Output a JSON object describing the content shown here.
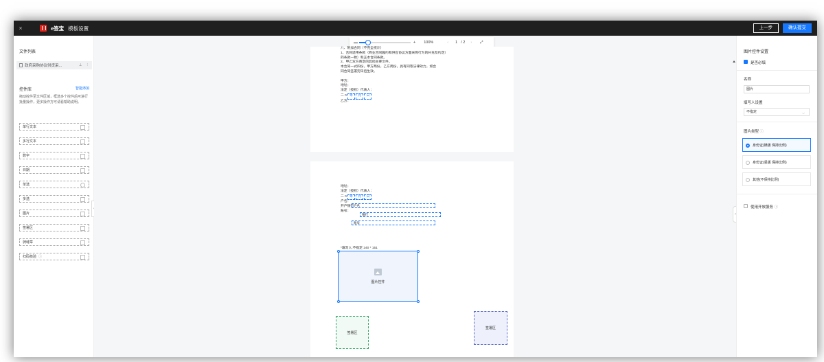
{
  "topbar": {
    "close": "×",
    "app_name": "e签宝",
    "page_title": "模板设置",
    "prev_label": "上一步",
    "submit_label": "确认提交"
  },
  "left": {
    "file_list_title": "文件列表",
    "file_name": "政府采购协议供货采...",
    "library_title": "控件库",
    "batch_add": "智能添加",
    "library_desc": "拖动控件至文件区域，框选多个控件后可进行批量操作，更多操作方可请看帮助说明。",
    "controls": [
      "单行文本",
      "多行文本",
      "数字",
      "日期",
      "单选",
      "多选",
      "图片",
      "签署区",
      "骑缝章",
      "扫码核验"
    ]
  },
  "toolbar": {
    "zoom": "100%",
    "page": "1",
    "total": "/ 2"
  },
  "page1": {
    "lines": [
      "八、附加合同（不完全统计）",
      "1、合同适用条款（商业合同履约和供应协议方面采购行为的补充及约定）",
      "的条款一致）和正本合同条款。",
      "2、甲乙双方商定的其他主要文件。",
      "本合同一式四份，甲方两份，乙方两份，具有同等法律效力，如合",
      "同合同签署完毕后生效。",
      "",
      "甲方：",
      "地址：",
      "法定（授权）代表人：",
      "二 0"
    ],
    "date_fields": [
      "年",
      "月",
      "日"
    ],
    "party_b": "乙方："
  },
  "page2": {
    "address": "地址：",
    "rep": "法定（授权）代表人：",
    "year_prefix": "二 0",
    "date_fields": [
      "年",
      "月",
      "日"
    ],
    "account_name_label": "户名：",
    "account_name_value": "户名",
    "bank_label": "开户银行：",
    "bank_value": "银行",
    "account_no_label": "账号：",
    "account_no_value": "账号",
    "size_label": "*填写人:不指定   240 * 151",
    "image_control_label": "图片控件",
    "sign_green": "签署区",
    "sign_blue": "签署区"
  },
  "right": {
    "title": "图片控件设置",
    "required_label": "是否必填",
    "name_label": "名称",
    "name_value": "图片",
    "filler_label": "填写人设置",
    "filler_value": "不指定",
    "type_label": "图片类型",
    "options": [
      "身份证(横版 保持比例)",
      "身份证(竖版 保持比例)",
      "其他(不保持比例)"
    ],
    "open_config": "使用开放服务"
  }
}
